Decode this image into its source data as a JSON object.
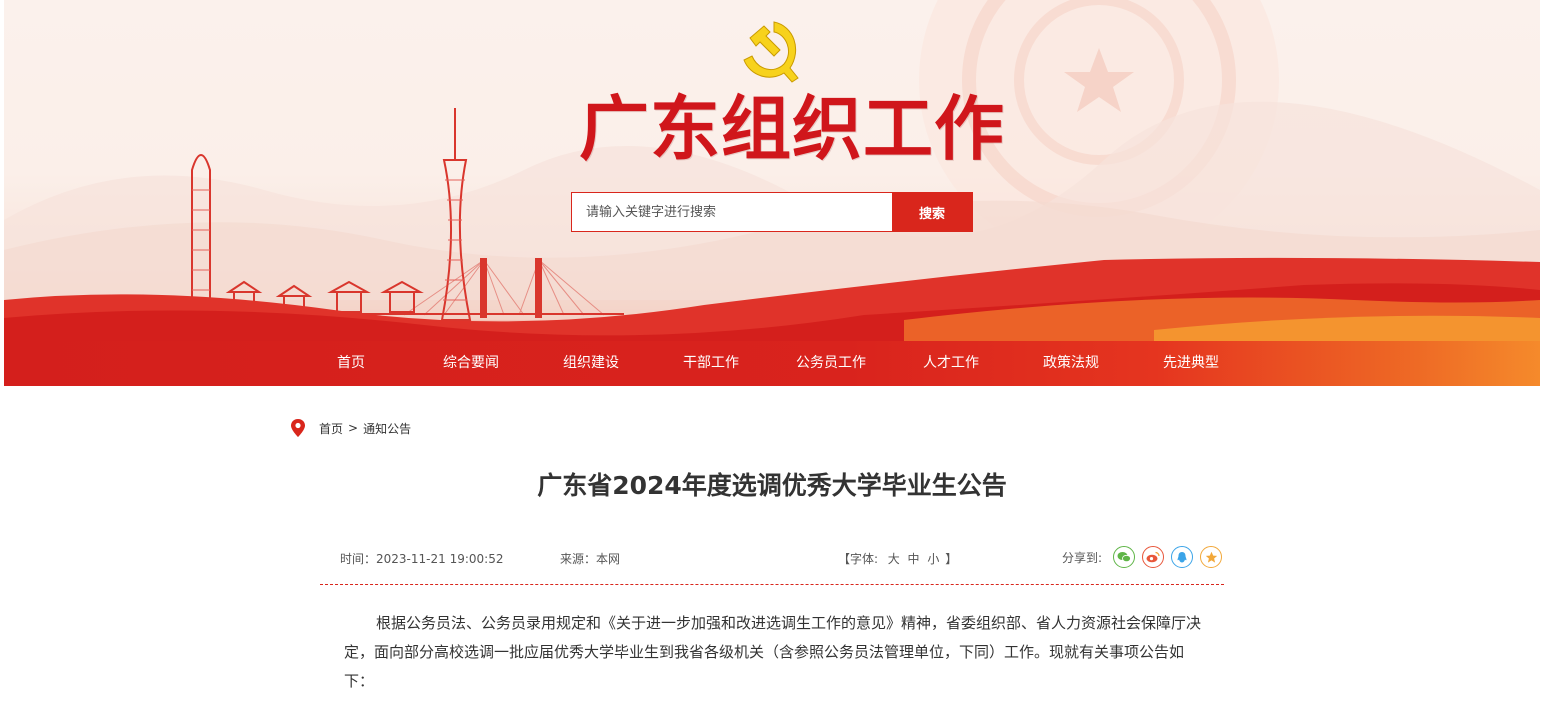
{
  "header": {
    "site_title": "广东组织工作",
    "search": {
      "placeholder": "请输入关键字进行搜索",
      "button_label": "搜索"
    }
  },
  "nav": {
    "items": [
      {
        "label": "首页"
      },
      {
        "label": "综合要闻"
      },
      {
        "label": "组织建设"
      },
      {
        "label": "干部工作"
      },
      {
        "label": "公务员工作"
      },
      {
        "label": "人才工作"
      },
      {
        "label": "政策法规"
      },
      {
        "label": "先进典型"
      }
    ]
  },
  "breadcrumb": {
    "home": "首页",
    "separator": ">",
    "current": "通知公告"
  },
  "article": {
    "title": "广东省2024年度选调优秀大学毕业生公告",
    "time_label": "时间：",
    "time": "2023-11-21 19:00:52",
    "source_label": "来源：",
    "source": "本网",
    "font_size": {
      "open": "【字体:",
      "large": "大",
      "medium": "中",
      "small": "小",
      "close": "】"
    },
    "share_label": "分享到:",
    "share_icons": [
      "wechat-icon",
      "weibo-icon",
      "qq-icon",
      "qzone-icon"
    ],
    "body": "根据公务员法、公务员录用规定和《关于进一步加强和改进选调生工作的意见》精神，省委组织部、省人力资源社会保障厅决定，面向部分高校选调一批应届优秀大学毕业生到我省各级机关（含参照公务员法管理单位，下同）工作。现就有关事项公告如下："
  },
  "colors": {
    "brand_red": "#d9261c",
    "title_red": "#d0161b",
    "nav_orange": "#f58a2b"
  }
}
